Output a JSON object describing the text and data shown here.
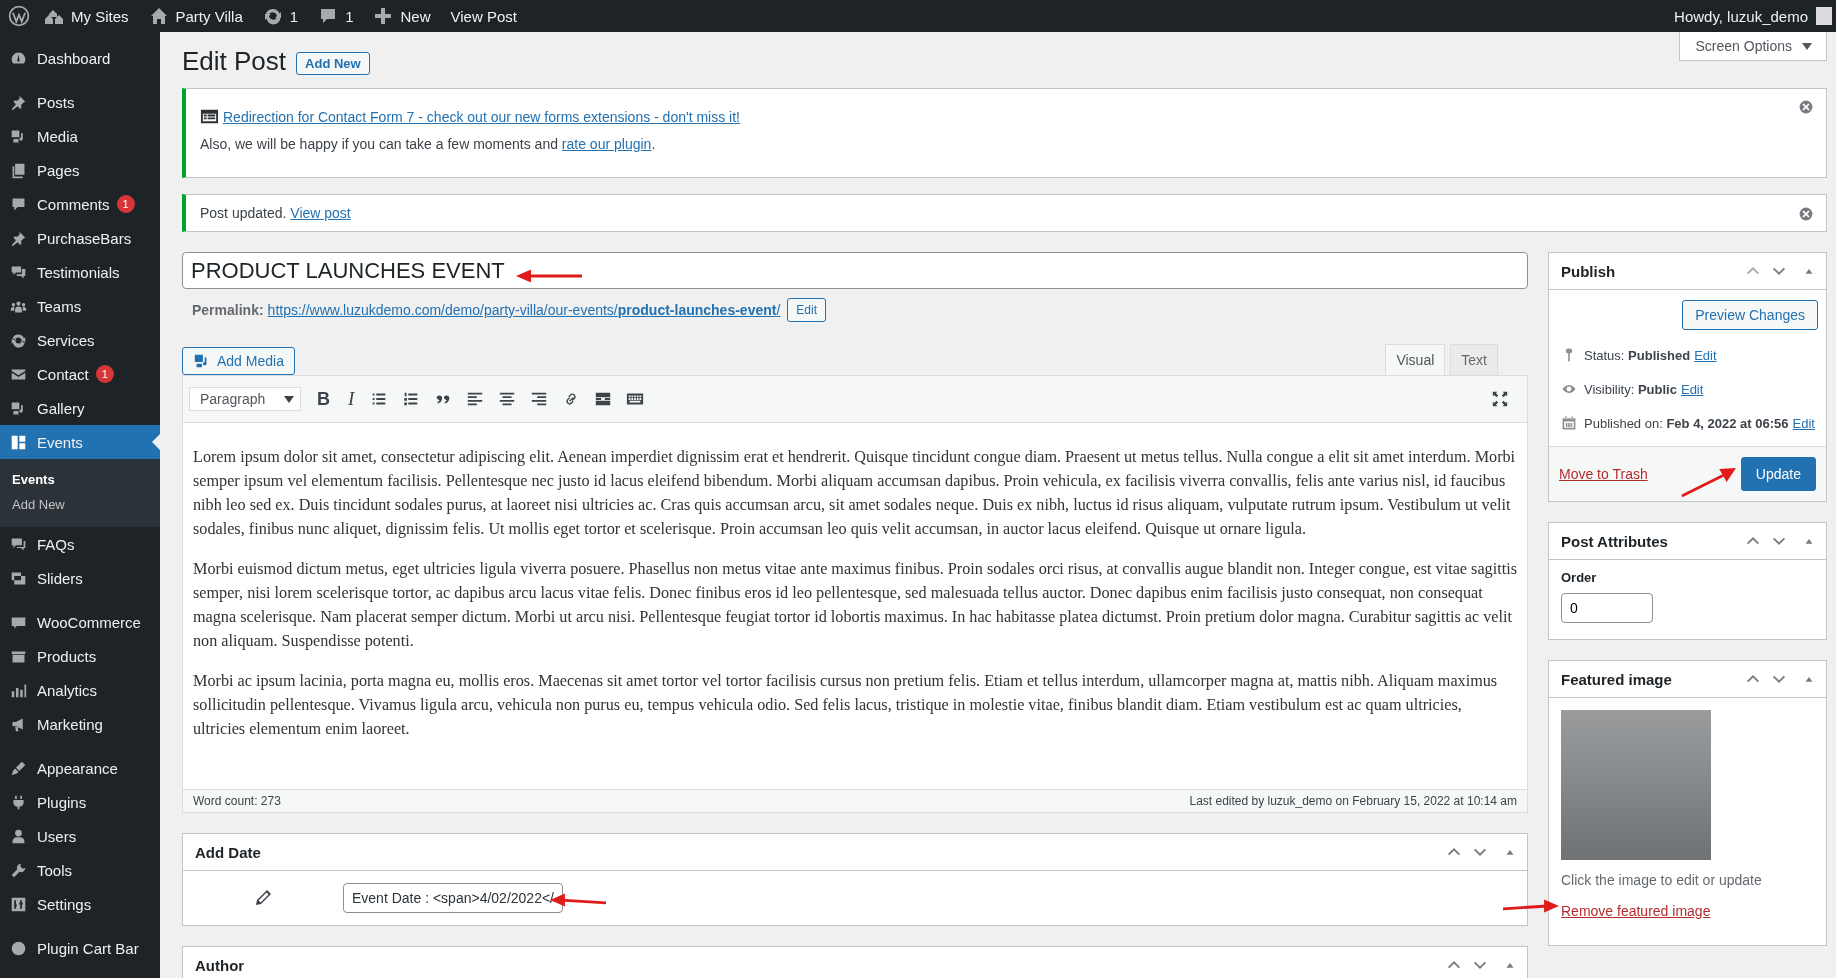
{
  "admin_bar": {
    "items": [
      {
        "kind": "sites",
        "label": "My Sites"
      },
      {
        "kind": "home",
        "label": "Party Villa"
      },
      {
        "kind": "updates",
        "label": "1"
      },
      {
        "kind": "comments",
        "label": "1"
      },
      {
        "kind": "new",
        "label": "New"
      },
      {
        "kind": "view",
        "label": "View Post"
      }
    ],
    "greeting": "Howdy, luzuk_demo"
  },
  "sidebar": {
    "groups": [
      {
        "items": [
          {
            "label": "Dashboard",
            "selected": false
          }
        ]
      },
      {
        "items": [
          {
            "label": "Posts",
            "selected": false
          },
          {
            "label": "Media",
            "selected": false
          },
          {
            "label": "Pages",
            "selected": false
          },
          {
            "label": "Comments",
            "selected": false,
            "badge": "1"
          },
          {
            "label": "PurchaseBars",
            "selected": false
          },
          {
            "label": "Testimonials",
            "selected": false
          },
          {
            "label": "Teams",
            "selected": false
          },
          {
            "label": "Services",
            "selected": false
          },
          {
            "label": "Contact",
            "selected": false,
            "badge": "1"
          },
          {
            "label": "Gallery",
            "selected": false
          },
          {
            "label": "Events",
            "selected": true,
            "submenu": [
              {
                "label": "Events",
                "selected": true
              },
              {
                "label": "Add New",
                "selected": false
              }
            ]
          },
          {
            "label": "FAQs",
            "selected": false
          },
          {
            "label": "Sliders",
            "selected": false
          }
        ]
      },
      {
        "items": [
          {
            "label": "WooCommerce",
            "selected": false
          },
          {
            "label": "Products",
            "selected": false
          },
          {
            "label": "Analytics",
            "selected": false
          },
          {
            "label": "Marketing",
            "selected": false
          }
        ]
      },
      {
        "items": [
          {
            "label": "Appearance",
            "selected": false
          },
          {
            "label": "Plugins",
            "selected": false
          },
          {
            "label": "Users",
            "selected": false
          },
          {
            "label": "Tools",
            "selected": false
          },
          {
            "label": "Settings",
            "selected": false
          }
        ]
      },
      {
        "items": [
          {
            "label": "Plugin Cart Bar",
            "selected": false
          }
        ]
      }
    ]
  },
  "page": {
    "title": "Edit Post",
    "add_new": "Add New",
    "screen_options": "Screen Options"
  },
  "notices": [
    {
      "kind": "promo",
      "link": "Redirection for Contact Form 7 - check out our new forms extensions - don't miss it!",
      "text": "Also, we will be happy if you can take a few moments and",
      "text_link": "rate our plugin",
      "text_after": "."
    },
    {
      "kind": "updated",
      "text": "Post updated.",
      "text_link": "View post"
    }
  ],
  "post": {
    "title": "PRODUCT LAUNCHES EVENT",
    "permalink_label": "Permalink:",
    "permalink": "https://www.luzukdemo.com/demo/party-villa/our-events/**product-launches-event**/",
    "permalink_edit": "Edit"
  },
  "editor": {
    "add_media": "Add Media",
    "tabs": [
      {
        "label": "Visual",
        "selected": true
      },
      {
        "label": "Text",
        "selected": false
      }
    ],
    "format": "Paragraph",
    "bold": "B",
    "italic": "I",
    "paragraphs": [
      "Lorem ipsum dolor sit amet, consectetur adipiscing elit. Aenean imperdiet dignissim erat et hendrerit. Quisque tincidunt congue diam. Praesent ut metus tellus. Nulla congue a elit sit amet interdum. Morbi semper ipsum vel elementum facilisis. Pellentesque nec justo id lacus eleifend bibendum. Morbi aliquam accumsan dapibus. Proin vehicula, ex facilisis viverra convallis, felis ante varius nisl, id faucibus nibh leo sed ex. Duis tincidunt sodales purus, at laoreet nisi ultricies ac. Cras quis accumsan arcu, sit amet sodales neque. Duis ex nibh, luctus id risus aliquam, vulputate rutrum ipsum. Vestibulum ut velit sodales, finibus nunc aliquet, dignissim felis. Ut mollis eget tortor et scelerisque. Proin accumsan leo quis velit accumsan, in auctor lacus eleifend. Quisque ut ornare ligula.",
      "Morbi euismod dictum metus, eget ultricies ligula viverra posuere. Phasellus non metus vitae ante maximus finibus. Proin sodales orci risus, at convallis augue blandit non. Integer congue, est vitae sagittis semper, nisi lorem scelerisque tortor, ac dapibus arcu lacus vitae felis. Donec finibus eros id leo pellentesque, sed malesuada tellus auctor. Donec dapibus enim facilisis justo consequat, non consequat magna scelerisque. Nam placerat semper dictum. Morbi ut arcu nisi. Pellentesque feugiat tortor id lobortis maximus. In hac habitasse platea dictumst. Proin pretium dolor magna. Curabitur sagittis ac velit non aliquam. Suspendisse potenti.",
      "Morbi ac ipsum lacinia, porta magna eu, mollis eros. Maecenas sit amet tortor vel tortor facilisis cursus non pretium felis. Etiam et tellus interdum, ullamcorper magna at, mattis nibh. Aliquam maximus sollicitudin pellentesque. Vivamus ligula arcu, vehicula non purus eu, tempus vehicula odio. Sed felis lacus, tristique in molestie vitae, finibus blandit diam. Etiam vestibulum est ac quam ultricies, ultricies elementum enim laoreet."
    ],
    "word_count": "Word count: 273",
    "last_edited": "Last edited by luzuk_demo on February 15, 2022 at 10:14 am"
  },
  "add_date": {
    "title": "Add Date",
    "value": "Event Date : <span>4/02/2022</"
  },
  "author": {
    "title": "Author"
  },
  "publish": {
    "title": "Publish",
    "preview": "Preview Changes",
    "rows": [
      {
        "kind": "status",
        "label": "Status:",
        "value": "Published",
        "edit": "Edit"
      },
      {
        "kind": "visibility",
        "label": "Visibility:",
        "value": "Public",
        "edit": "Edit"
      },
      {
        "kind": "date",
        "label": "Published on:",
        "value": "Feb 4, 2022 at 06:56",
        "edit": "Edit"
      }
    ],
    "trash": "Move to Trash",
    "update": "Update"
  },
  "attributes": {
    "title": "Post Attributes",
    "order_label": "Order",
    "order": "0"
  },
  "featured": {
    "title": "Featured image",
    "hint": "Click the image to edit or update",
    "remove": "Remove featured image"
  }
}
